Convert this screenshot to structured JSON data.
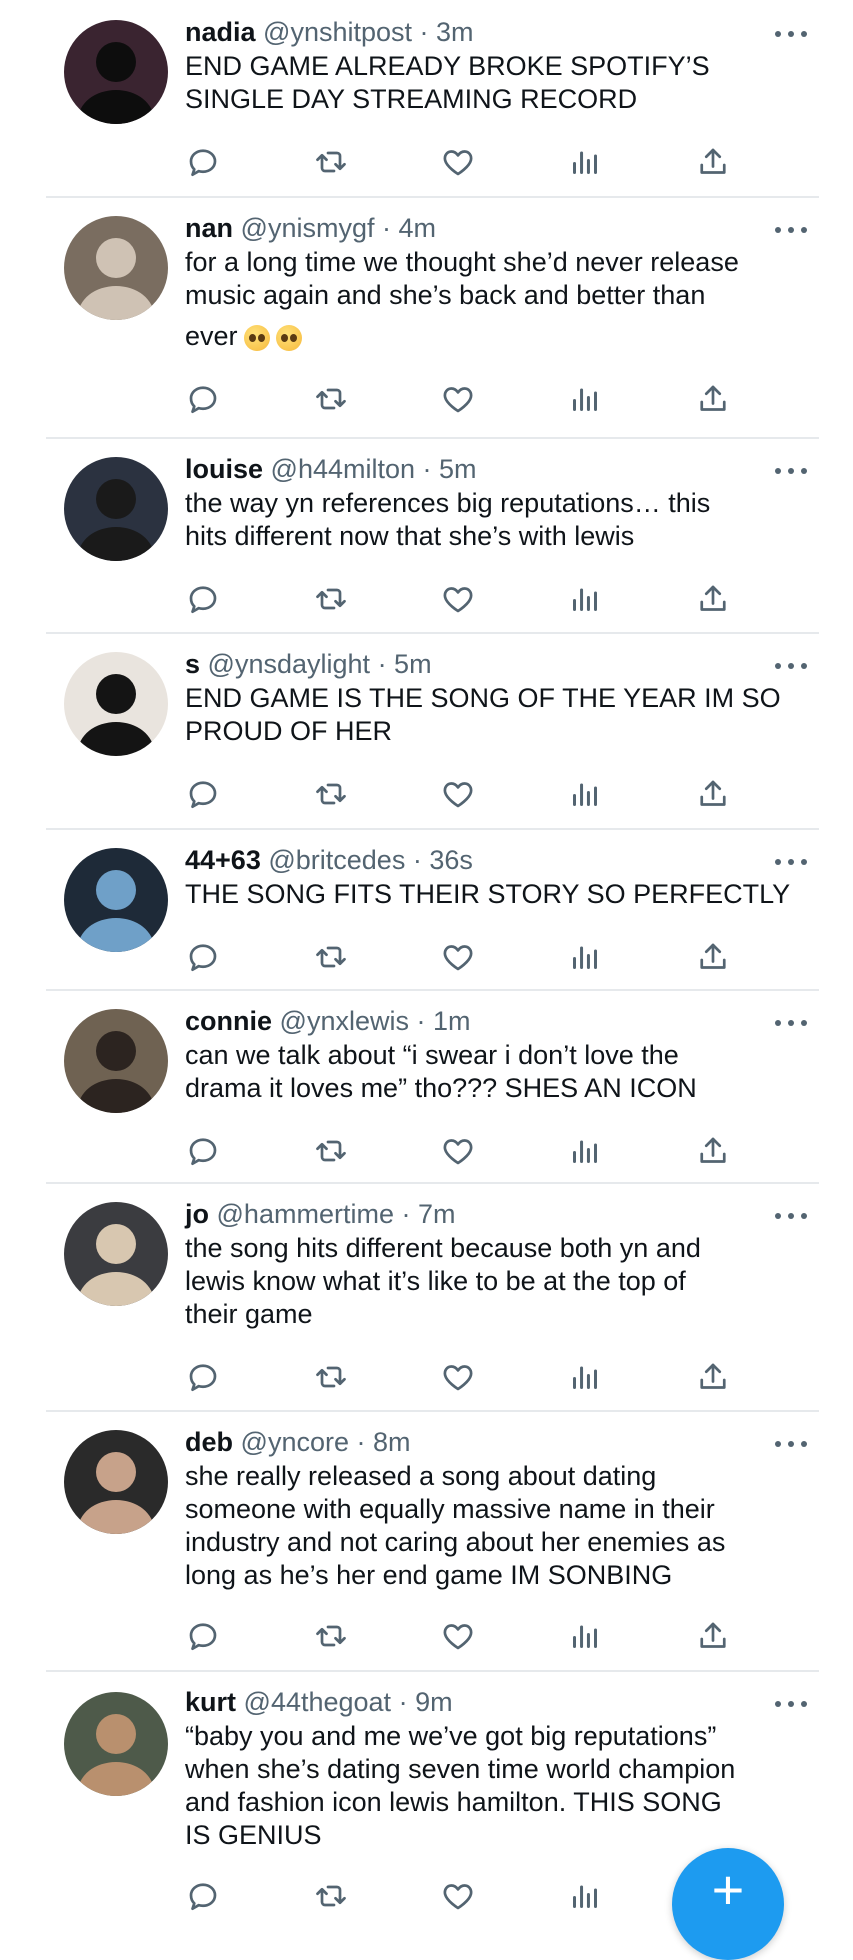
{
  "tweets": [
    {
      "name": "nadia",
      "handle": "@ynshitpost",
      "time": "· 3m",
      "lines": [
        "END GAME ALREADY BROKE SPOTIFY’S",
        "SINGLE DAY STREAMING RECORD"
      ]
    },
    {
      "name": "nan",
      "handle": "@ynismygf",
      "time": "· 4m",
      "lines": [
        "for a long time we thought she’d never release",
        "music again and she’s back and better than",
        "ever"
      ]
    },
    {
      "name": "louise",
      "handle": "@h44milton",
      "time": "· 5m",
      "lines": [
        "the way yn references big reputations… this",
        "hits different now that she’s with lewis"
      ]
    },
    {
      "name": "s",
      "handle": "@ynsdaylight",
      "time": "· 5m",
      "lines": [
        "END GAME IS THE SONG OF THE YEAR IM SO",
        "PROUD OF HER"
      ]
    },
    {
      "name": "44+63",
      "handle": "@britcedes",
      "time": "· 36s",
      "lines": [
        "THE SONG FITS THEIR STORY SO PERFECTLY"
      ]
    },
    {
      "name": "connie",
      "handle": "@ynxlewis",
      "time": "· 1m",
      "lines": [
        "can we talk about “i swear i don’t love the",
        "drama it loves me” tho??? SHES AN ICON"
      ]
    },
    {
      "name": "jo",
      "handle": "@hammertime",
      "time": "· 7m",
      "lines": [
        "the song hits different because both yn and",
        "lewis know what it’s like to be at the top of",
        "their game"
      ]
    },
    {
      "name": "deb",
      "handle": "@yncore",
      "time": "· 8m",
      "lines": [
        "she really released a song about dating",
        "someone with equally massive name in their",
        "industry and not caring about her enemies as",
        "long as he’s her end game IM SONBING"
      ]
    },
    {
      "name": "kurt",
      "handle": "@44thegoat",
      "time": "· 9m",
      "lines": [
        "“baby you and me we’ve got big reputations”",
        "when she’s dating seven time world champion",
        "and fashion icon lewis hamilton. THIS SONG",
        "IS GENIUS"
      ]
    }
  ],
  "icons": {
    "reply": "reply-icon",
    "retweet": "retweet-icon",
    "like": "heart-icon",
    "views": "views-icon",
    "share": "share-icon",
    "more": "more-icon",
    "compose": "plus-icon"
  },
  "fab": {
    "label": "+"
  },
  "colors": {
    "text": "#0f1419",
    "secondary": "#536471",
    "accent": "#1d9bf0",
    "divider": "#e6e9ec"
  }
}
